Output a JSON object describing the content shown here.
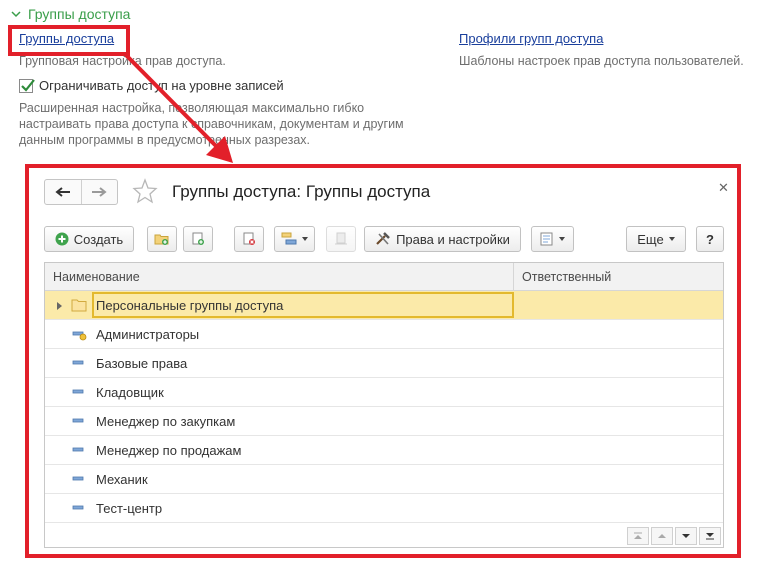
{
  "settings": {
    "section_title": "Группы доступа",
    "groups_link": "Группы доступа",
    "groups_hint": "Групповая настройка прав доступа.",
    "profiles_link": "Профили групп доступа",
    "profiles_hint": "Шаблоны настроек прав доступа пользователей.",
    "restrict_checkbox_label": "Ограничивать доступ на уровне записей",
    "restrict_checked": true,
    "restrict_hint": "Расширенная настройка, позволяющая максимально гибко настраивать права доступа к справочникам, документам и другим данным программы в предусмотренных разрезах."
  },
  "window": {
    "title": "Группы доступа: Группы доступа",
    "toolbar": {
      "create_label": "Создать",
      "rights_label": "Права и настройки",
      "more_label": "Еще",
      "help_label": "?"
    },
    "grid": {
      "columns": [
        "Наименование",
        "Ответственный"
      ],
      "rows": [
        {
          "name": "Персональные группы доступа",
          "responsible": "",
          "type": "folder",
          "selected": true
        },
        {
          "name": "Администраторы",
          "responsible": "",
          "type": "admin",
          "selected": false
        },
        {
          "name": "Базовые права",
          "responsible": "",
          "type": "item",
          "selected": false
        },
        {
          "name": "Кладовщик",
          "responsible": "",
          "type": "item",
          "selected": false
        },
        {
          "name": "Менеджер по закупкам",
          "responsible": "",
          "type": "item",
          "selected": false
        },
        {
          "name": "Менеджер по продажам",
          "responsible": "",
          "type": "item",
          "selected": false
        },
        {
          "name": "Механик",
          "responsible": "",
          "type": "item",
          "selected": false
        },
        {
          "name": "Тест-центр",
          "responsible": "",
          "type": "item",
          "selected": false
        }
      ]
    }
  },
  "colors": {
    "annotation_red": "#e2202a",
    "section_green": "#3a9e4a",
    "link_blue": "#1a3f9c",
    "selection_yellow": "#fbeaa9"
  }
}
